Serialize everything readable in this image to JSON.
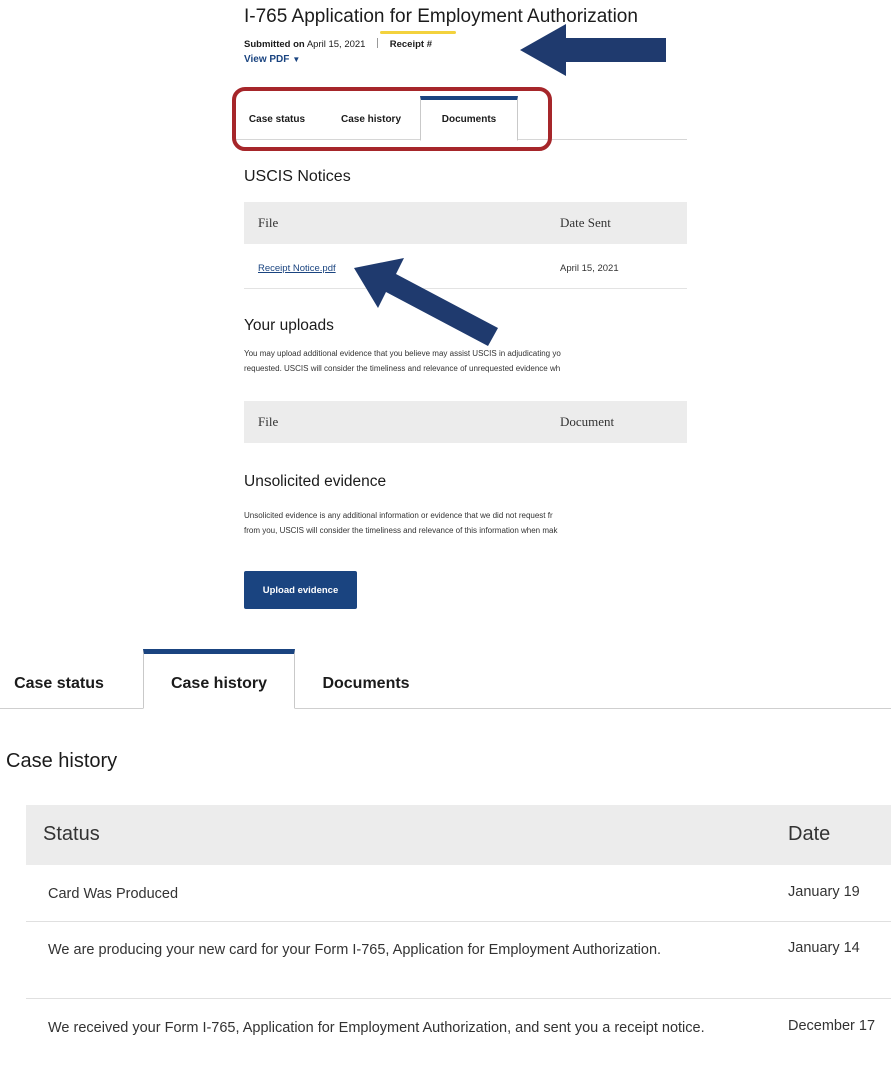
{
  "top": {
    "app_title": "I-765 Application for Employment Authorization",
    "submitted_label": "Submitted on",
    "submitted_date": "April 15, 2021",
    "receipt_label": "Receipt #",
    "view_pdf_label": "View PDF",
    "tabs": [
      {
        "label": "Case status"
      },
      {
        "label": "Case history"
      },
      {
        "label": "Documents"
      }
    ],
    "active_tab": "Documents",
    "notices": {
      "heading": "USCIS Notices",
      "col_file": "File",
      "col_date": "Date Sent",
      "rows": [
        {
          "file": "Receipt Notice.pdf",
          "date": "April 15, 2021"
        }
      ]
    },
    "uploads": {
      "heading": "Your uploads",
      "line1": "You may upload additional evidence that you believe may assist USCIS in adjudicating yo",
      "line2": "requested. USCIS will consider the timeliness and relevance of unrequested evidence wh",
      "col_file": "File",
      "col_document": "Document"
    },
    "unsolicited": {
      "heading": "Unsolicited evidence",
      "line1": "Unsolicited evidence is any additional information or evidence that we did not request fr",
      "line2": "from you, USCIS will consider the timeliness and relevance of this information when mak"
    },
    "upload_button": "Upload evidence",
    "colors": {
      "accent": "#1a4480",
      "highlight_box": "#a6262a",
      "arrow": "#1f3a6e",
      "underline": "#f3d23d"
    }
  },
  "bottom": {
    "tabs": [
      {
        "label": "Case status"
      },
      {
        "label": "Case history"
      },
      {
        "label": "Documents"
      }
    ],
    "active_tab": "Case history",
    "heading": "Case history",
    "col_status": "Status",
    "col_date": "Date",
    "rows": [
      {
        "status": "Card Was Produced",
        "date": "January 19"
      },
      {
        "status": "We are producing your new card for your Form I-765, Application for Employment Authorization.",
        "date": "January 14"
      },
      {
        "status": "We received your Form I-765, Application for Employment Authorization, and sent you a receipt notice.",
        "date": "December 17"
      }
    ]
  }
}
